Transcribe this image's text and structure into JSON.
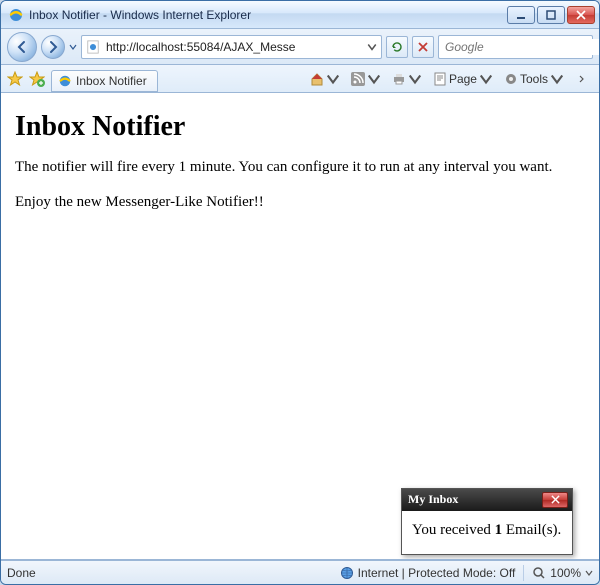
{
  "window": {
    "title": "Inbox Notifier - Windows Internet Explorer"
  },
  "nav": {
    "url": "http://localhost:55084/AJAX_Messe",
    "search_provider": "Google"
  },
  "tab": {
    "label": "Inbox Notifier"
  },
  "commandbar": {
    "page_label": "Page",
    "tools_label": "Tools"
  },
  "page": {
    "heading": "Inbox Notifier",
    "line1": "The notifier will fire every 1 minute. You can configure it to run at any interval you want.",
    "line2": "Enjoy the new Messenger-Like Notifier!!"
  },
  "notifier": {
    "title": "My Inbox",
    "prefix": "You received ",
    "count": "1",
    "suffix": " Email(s)."
  },
  "status": {
    "state": "Done",
    "zone": "Internet | Protected Mode: Off",
    "zoom": "100%"
  }
}
